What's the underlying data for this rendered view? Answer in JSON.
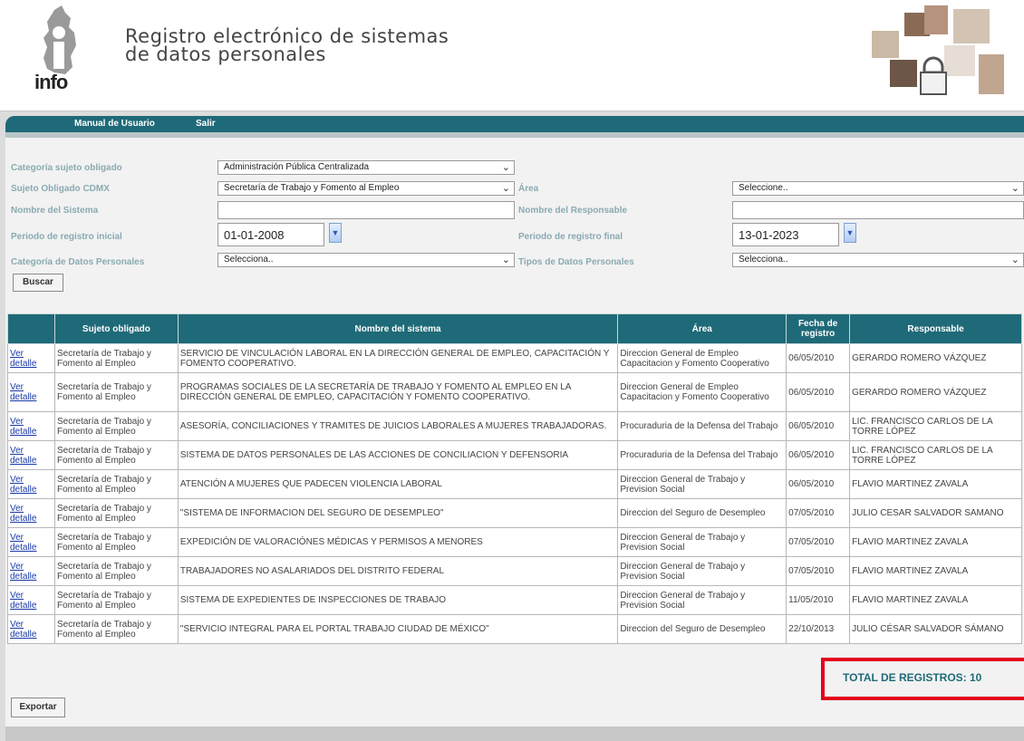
{
  "header": {
    "logo_text": "info",
    "title_line1": "Registro electrónico de sistemas",
    "title_line2": "de datos personales"
  },
  "nav": {
    "manual_label": "Manual de Usuario",
    "exit_label": "Salir"
  },
  "form": {
    "categoria_sujeto": {
      "label": "Categoría sujeto obligado",
      "value": "Administración Pública Centralizada"
    },
    "sujeto_obligado": {
      "label": "Sujeto Obligado CDMX",
      "value": "Secretaría de Trabajo y Fomento al Empleo"
    },
    "area": {
      "label": "Área",
      "value": "Seleccione.."
    },
    "nombre_sistema": {
      "label": "Nombre del Sistema",
      "value": ""
    },
    "nombre_responsable": {
      "label": "Nombre del Responsable",
      "value": ""
    },
    "periodo_inicial": {
      "label": "Periodo de registro inicial",
      "value": "01-01-2008"
    },
    "periodo_final": {
      "label": "Periodo de registro final",
      "value": "13-01-2023"
    },
    "categoria_datos": {
      "label": "Categoría de Datos Personales",
      "value": "Selecciona.."
    },
    "tipos_datos": {
      "label": "Tipos de Datos Personales",
      "value": "Selecciona.."
    },
    "search_button": "Buscar"
  },
  "table": {
    "headers": [
      "",
      "Sujeto obligado",
      "Nombre del sistema",
      "Área",
      "Fecha de registro",
      "Responsable"
    ],
    "link_label": "Ver detalle",
    "rows": [
      {
        "sujeto": "Secretaría de Trabajo y Fomento al Empleo",
        "sistema": "SERVICIO DE VINCULACIÓN LABORAL EN LA DIRECCIÓN GENERAL DE EMPLEO, CAPACITACIÓN Y FOMENTO COOPERATIVO.",
        "area": "Direccion General de Empleo Capacitacion y Fomento Cooperativo",
        "fecha": "06/05/2010",
        "responsable": "GERARDO ROMERO VÁZQUEZ"
      },
      {
        "sujeto": "Secretaría de Trabajo y Fomento al Empleo",
        "sistema": "PROGRAMAS SOCIALES DE LA SECRETARÍA DE TRABAJO Y FOMENTO AL EMPLEO EN LA DIRECCIÓN GENERAL DE EMPLEO, CAPACITACIÓN Y FOMENTO COOPERATIVO.",
        "area": "Direccion General de Empleo Capacitacion y Fomento Cooperativo",
        "fecha": "06/05/2010",
        "responsable": "GERARDO ROMERO VÁZQUEZ"
      },
      {
        "sujeto": "Secretaría de Trabajo y Fomento al Empleo",
        "sistema": "ASESORÍA, CONCILIACIONES Y TRAMITES DE JUICIOS LABORALES A MUJERES TRABAJADORAS.",
        "area": "Procuraduria de la Defensa del Trabajo",
        "fecha": "06/05/2010",
        "responsable": "LIC. FRANCISCO CARLOS DE LA TORRE LÓPEZ"
      },
      {
        "sujeto": "Secretaría de Trabajo y Fomento al Empleo",
        "sistema": "SISTEMA DE DATOS PERSONALES DE LAS ACCIONES DE CONCILIACION Y DEFENSORIA",
        "area": "Procuraduria de la Defensa del Trabajo",
        "fecha": "06/05/2010",
        "responsable": "LIC. FRANCISCO CARLOS DE LA TORRE LÓPEZ"
      },
      {
        "sujeto": "Secretaría de Trabajo y Fomento al Empleo",
        "sistema": "ATENCIÓN A MUJERES QUE PADECEN VIOLENCIA LABORAL",
        "area": "Direccion General de Trabajo y Prevision Social",
        "fecha": "06/05/2010",
        "responsable": "FLAVIO MARTINEZ ZAVALA"
      },
      {
        "sujeto": "Secretaría de Trabajo y Fomento al Empleo",
        "sistema": "\"SISTEMA DE INFORMACION DEL SEGURO DE DESEMPLEO\"",
        "area": "Direccion del Seguro de Desempleo",
        "fecha": "07/05/2010",
        "responsable": "JULIO CESAR SALVADOR SAMANO"
      },
      {
        "sujeto": "Secretaría de Trabajo y Fomento al Empleo",
        "sistema": "EXPEDICIÓN DE VALORACIÓNES MÉDICAS Y PERMISOS A MENORES",
        "area": "Direccion General de Trabajo y Prevision Social",
        "fecha": "07/05/2010",
        "responsable": "FLAVIO MARTINEZ ZAVALA"
      },
      {
        "sujeto": "Secretaría de Trabajo y Fomento al Empleo",
        "sistema": "TRABAJADORES NO ASALARIADOS DEL DISTRITO FEDERAL",
        "area": "Direccion General de Trabajo y Prevision Social",
        "fecha": "07/05/2010",
        "responsable": "FLAVIO MARTINEZ ZAVALA"
      },
      {
        "sujeto": "Secretaría de Trabajo y Fomento al Empleo",
        "sistema": "SISTEMA DE EXPEDIENTES DE INSPECCIONES DE TRABAJO",
        "area": "Direccion General de Trabajo y Prevision Social",
        "fecha": "11/05/2010",
        "responsable": "FLAVIO MARTINEZ ZAVALA"
      },
      {
        "sujeto": "Secretaría de Trabajo y Fomento al Empleo",
        "sistema": "\"SERVICIO INTEGRAL PARA EL PORTAL TRABAJO CIUDAD DE MÉXICO\"",
        "area": "Direccion del Seguro de Desempleo",
        "fecha": "22/10/2013",
        "responsable": "JULIO CÉSAR SALVADOR SÁMANO"
      }
    ]
  },
  "total_label": "TOTAL DE REGISTROS: 10",
  "export_button": "Exportar",
  "colors": {
    "primary_teal": "#1f6a78",
    "label_blue": "#8aaab2",
    "highlight_red": "#e3001b",
    "link_blue": "#1a3aa8"
  }
}
